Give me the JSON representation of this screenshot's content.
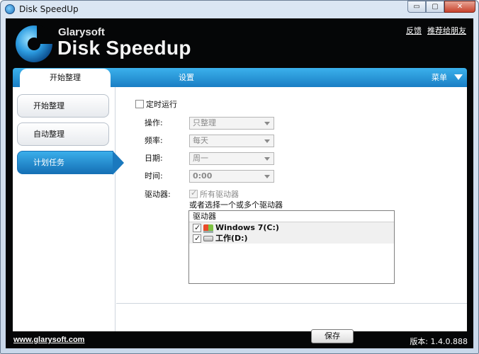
{
  "window": {
    "title": "Disk SpeedUp",
    "controls": {
      "minimize": "▭",
      "maximize": "▢",
      "close": "✕"
    }
  },
  "brand": {
    "company": "Glarysoft",
    "product": "Disk Speedup"
  },
  "top_links": {
    "feedback": "反馈",
    "recommend": "推荐给朋友"
  },
  "tabs": {
    "active": "开始整理",
    "settings": "设置",
    "menu": "菜单"
  },
  "sidebar": {
    "items": [
      {
        "label": "开始整理",
        "active": false
      },
      {
        "label": "自动整理",
        "active": false
      },
      {
        "label": "计划任务",
        "active": true
      }
    ]
  },
  "schedule": {
    "timed_run": {
      "label": "定时运行",
      "checked": false
    },
    "fields": [
      {
        "label": "操作:",
        "value": "只整理"
      },
      {
        "label": "频率:",
        "value": "每天"
      },
      {
        "label": "日期:",
        "value": "周一"
      },
      {
        "label": "时间:",
        "value": "0:00"
      }
    ],
    "drives_label": "驱动器:",
    "all_drives": {
      "label": "所有驱动器",
      "checked": true
    },
    "choose_text": "或者选择一个或多个驱动器",
    "drive_list": {
      "header": "驱动器",
      "items": [
        {
          "label": "Windows 7(C:)",
          "checked": true,
          "icon": "windows-drive-icon"
        },
        {
          "label": "工作(D:)",
          "checked": true,
          "icon": "hard-drive-icon"
        }
      ]
    },
    "save_label": "保存"
  },
  "footer": {
    "website": "www.glarysoft.com",
    "version": "版本: 1.4.0.888"
  },
  "colors": {
    "accent": "#1f8fd6",
    "background_dark": "#050607"
  }
}
